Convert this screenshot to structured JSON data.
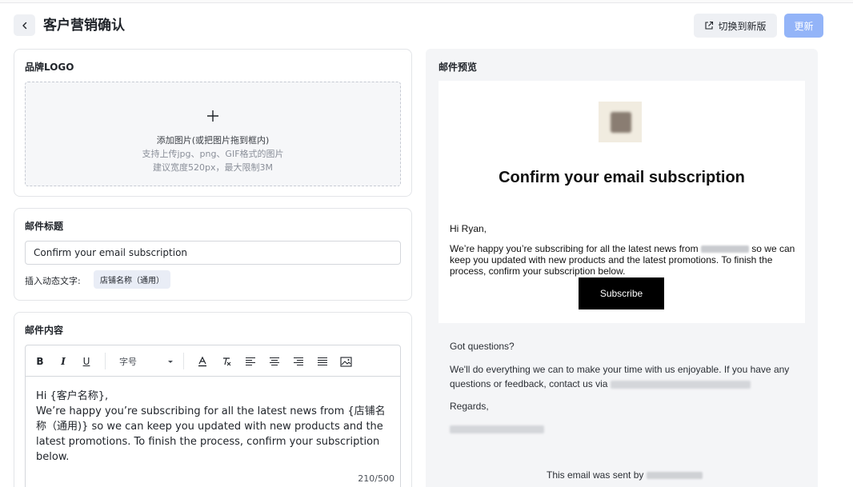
{
  "header": {
    "title": "客户营销确认",
    "switch_label": "切换到新版",
    "update_label": "更新",
    "update_color": "#93b4f8"
  },
  "logo_section": {
    "title": "品牌LOGO",
    "upload_main": "添加图片(或把图片拖到框内)",
    "upload_formats": "支持上传jpg、png、GIF格式的图片",
    "upload_limit": "建议宽度520px，最大限制3M"
  },
  "subject_section": {
    "title": "邮件标题",
    "value": "Confirm your email subscription",
    "insert_label": "插入动态文字:",
    "tag_label": "店铺名称（通用）"
  },
  "content_section": {
    "title": "邮件内容",
    "toolbar": {
      "bold": "B",
      "italic": "I",
      "underline": "U",
      "font_size": "字号"
    },
    "line1": "Hi {客户名称},",
    "line2": "We’re happy you’re subscribing for all the latest news from {店铺名称（通用)} so we can keep you updated with new products and the latest promotions. To finish the process, confirm your subscription below.",
    "counter": "210/500"
  },
  "preview": {
    "title": "邮件预览",
    "heading": "Confirm your email subscription",
    "greeting": "Hi Ryan,",
    "body_before": "We’re happy you’re subscribing for all the latest news from",
    "body_after": "so we can keep you updated with new products and the latest promotions. To finish the process, confirm your subscription below.",
    "subscribe_label": "Subscribe",
    "questions": "Got questions?",
    "help_text": "We'll do everything we can to make your time with us enjoyable. If you have any questions or feedback, contact us via",
    "regards": "Regards,",
    "sent_by": "This email was sent by"
  }
}
